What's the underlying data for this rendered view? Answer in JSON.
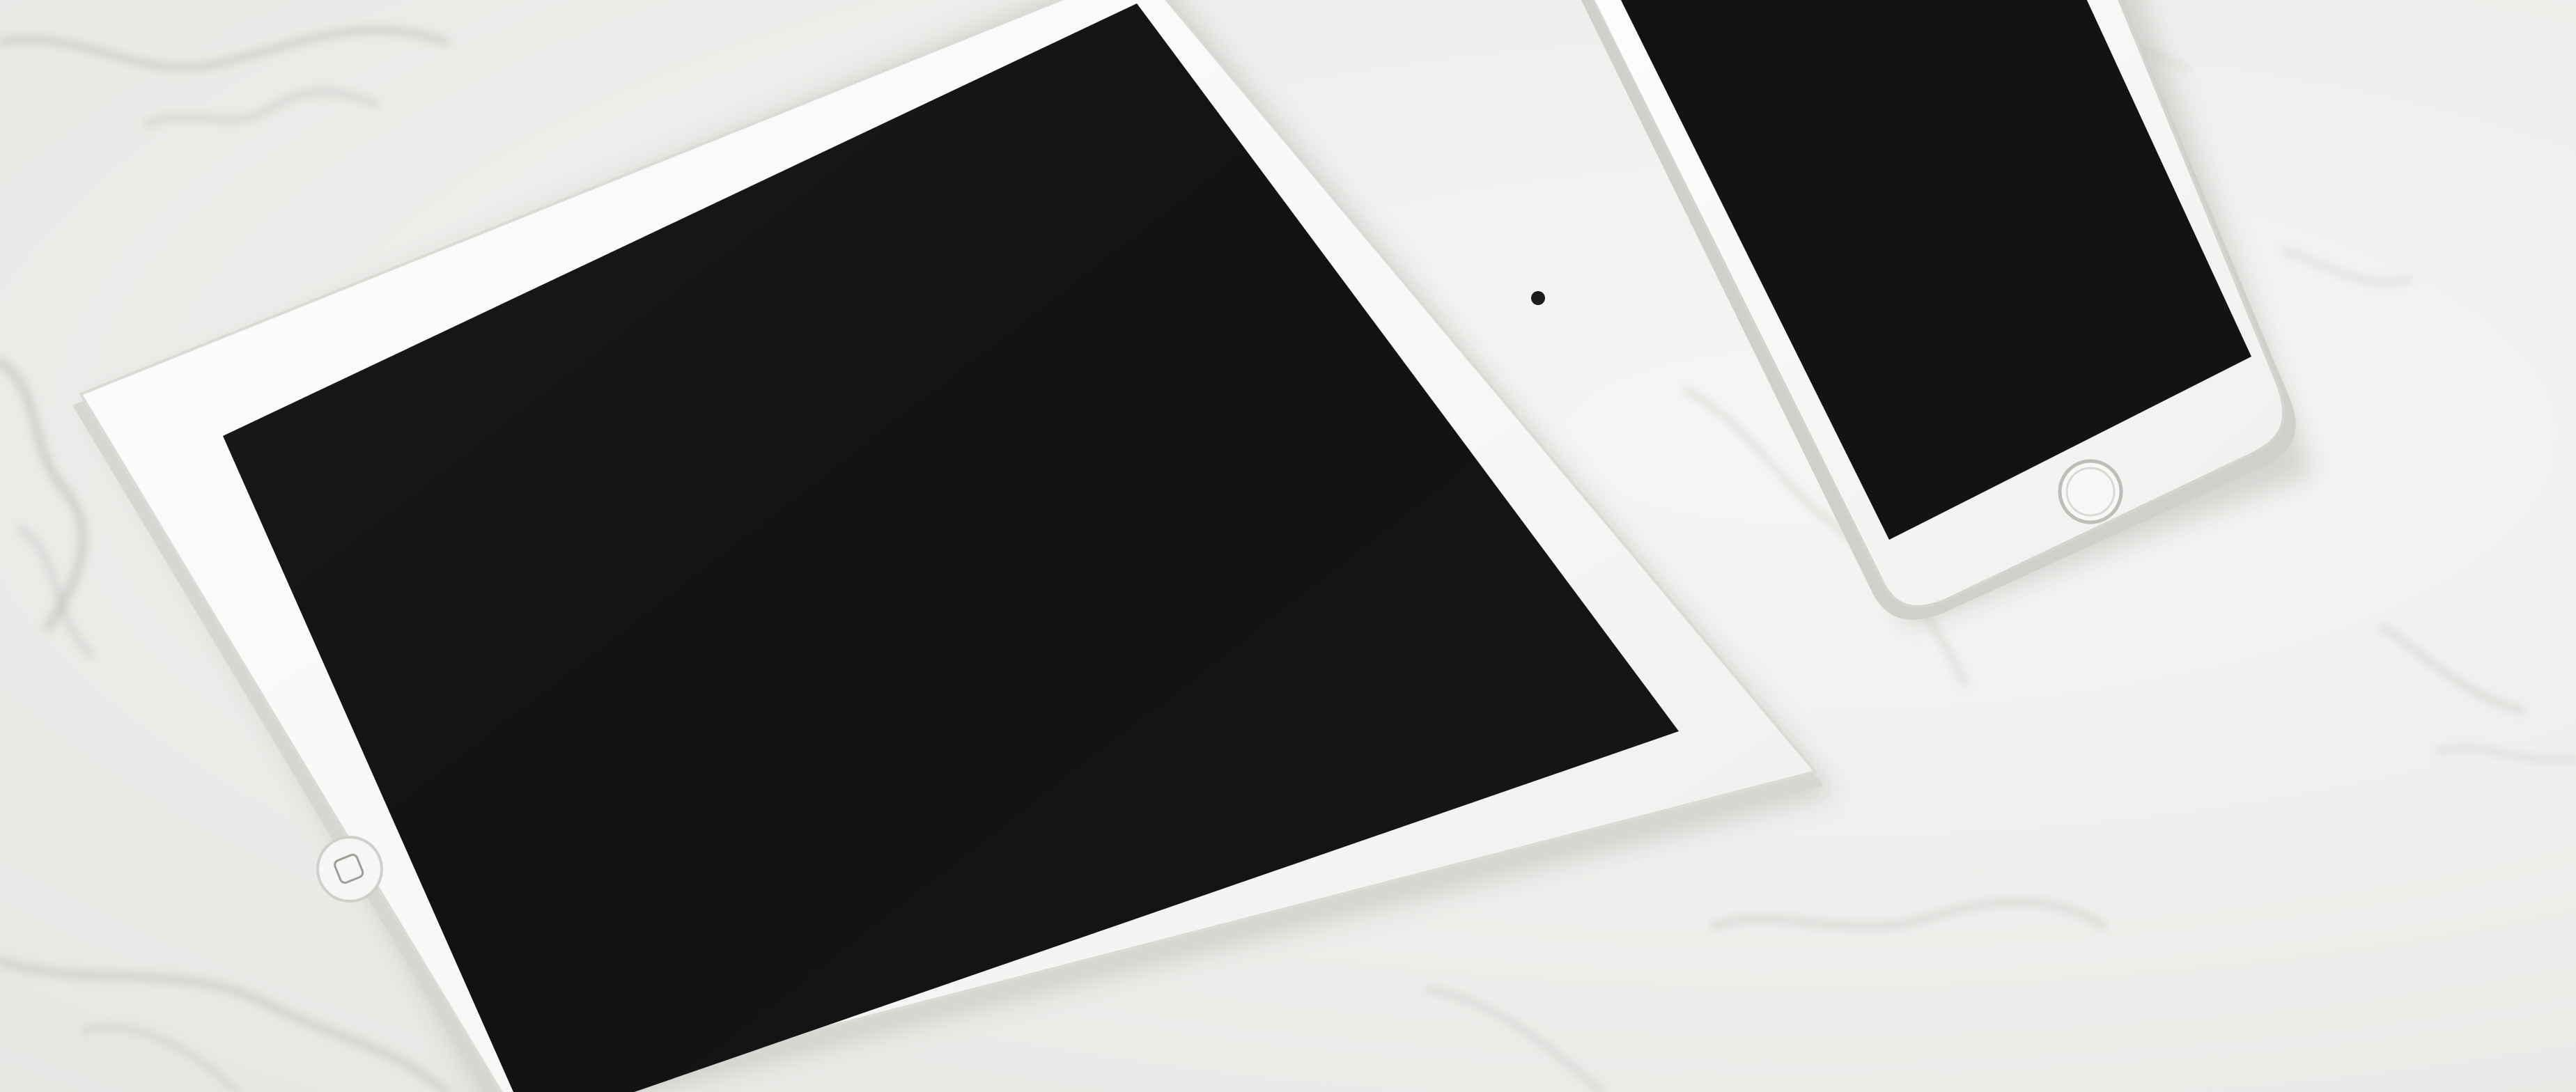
{
  "scene": {
    "description_free": true,
    "surface": {
      "material": "marble",
      "base_color": "#efefec",
      "vein_color": "#b9b9b6"
    },
    "devices": [
      {
        "kind": "tablet",
        "frame_color": "#fafafa",
        "edge_color": "#cfcfcc",
        "screen_color": "#141414",
        "home_button": "square-home-button-icon"
      },
      {
        "kind": "phone",
        "frame_color": "#fafafa",
        "edge_color": "#c9c9c6",
        "screen_color": "#131313",
        "home_button": "ring-home-button-icon"
      }
    ]
  }
}
